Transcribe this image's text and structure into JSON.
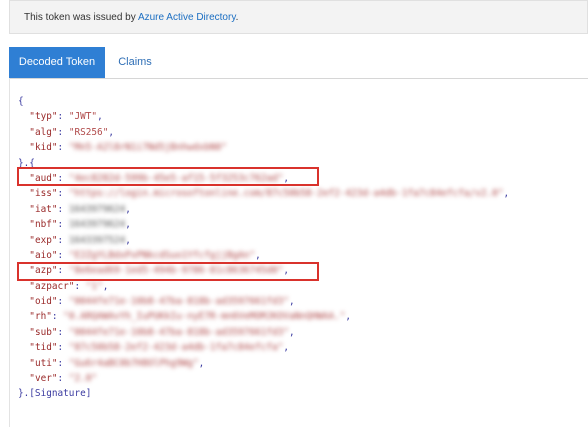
{
  "banner": {
    "prefix": "This token was issued by ",
    "link": "Azure Active Directory",
    "suffix": "."
  },
  "tabs": [
    {
      "label": "Decoded Token"
    },
    {
      "label": "Claims"
    }
  ],
  "header": {
    "open": "{",
    "typ_key": "\"typ\"",
    "typ_val": "\"JWT\"",
    "alg_key": "\"alg\"",
    "alg_val": "\"RS256\"",
    "kid_key": "\"kid\"",
    "kid_val": "\"Mn5-A2l8rN1i7Nd5jBnhwdxbN0\"",
    "close": "}.{"
  },
  "claims": [
    {
      "key": "\"aud\"",
      "value": "\"4ec8282d-599b-45e5-af15-5f3253c762ad\""
    },
    {
      "key": "\"iss\"",
      "value": "\"https://login.microsoftonline.com/87c50b58-2ef2-423d-a4db-1fa7c84efcfa/v2.0\""
    },
    {
      "key": "\"iat\"",
      "value": "1643979624"
    },
    {
      "key": "\"nbf\"",
      "value": "1643979624"
    },
    {
      "key": "\"exp\"",
      "value": "1643397524"
    },
    {
      "key": "\"aio\"",
      "value": "\"E2ZgYLBdxPxPNkcdSuo1YfcfgjjBgAn\""
    },
    {
      "key": "\"azp\"",
      "value": "\"8e6ead69-1ed5-494b-9786-81c8636745d0\""
    },
    {
      "key": "\"azpacr\"",
      "value": "\"1\""
    },
    {
      "key": "\"oid\"",
      "value": "\"0044fe71e-10b8-47ba-818b-ad3597661fd3\""
    },
    {
      "key": "\"rh\"",
      "value": "\"0.ARQAWAvYh_IuPUKkIu-nyE7R-mn6VeMOMJKOVaNnQHWAA.\""
    },
    {
      "key": "\"sub\"",
      "value": "\"0044fe71e-10b8-47ba-818b-ad3597661fd3\""
    },
    {
      "key": "\"tid\"",
      "value": "\"87c50b58-2ef2-423d-a4db-1fa7c84efcfa\""
    },
    {
      "key": "\"uti\"",
      "value": "\"Gu6r4aBC0b7H8OlPhg9Wg\""
    },
    {
      "key": "\"ver\"",
      "value": "\"2.0\""
    }
  ],
  "footer": "}.[Signature]"
}
